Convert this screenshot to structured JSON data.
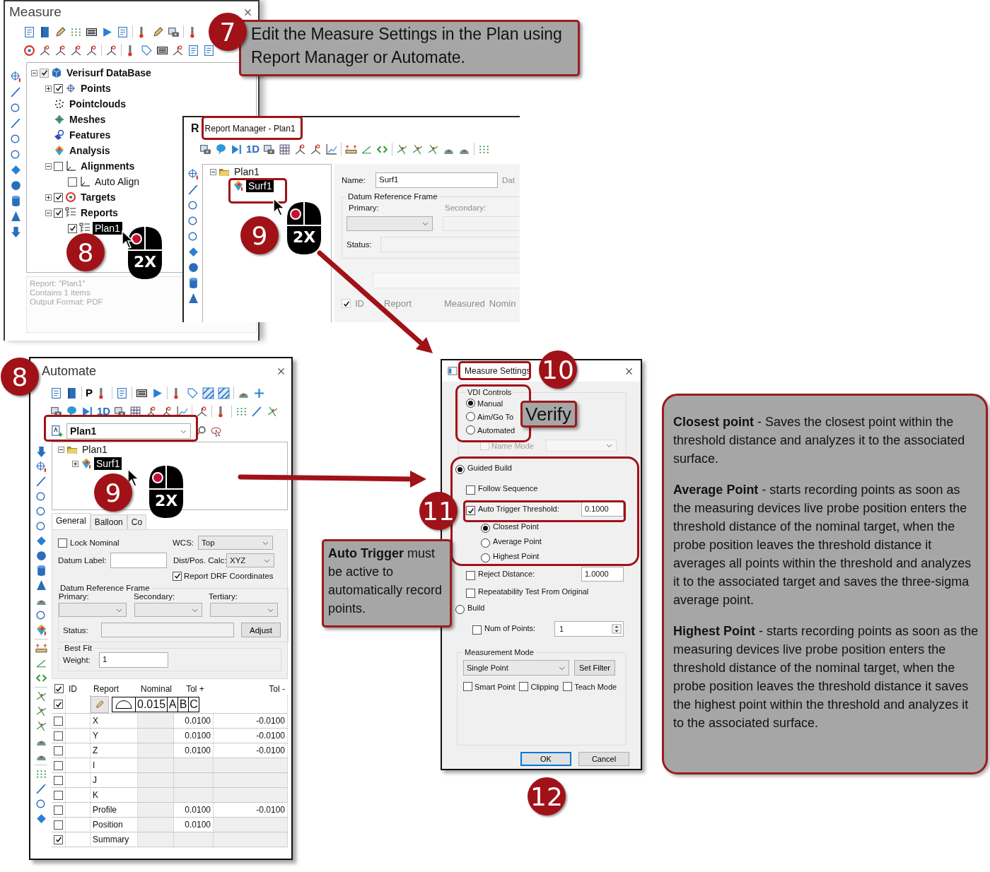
{
  "measure_window": {
    "title": "Measure",
    "tree": [
      {
        "label": "Verisurf DataBase",
        "kind": "database",
        "expanded": true,
        "checked": true,
        "selected": false,
        "children": [
          {
            "label": "Points",
            "kind": "point",
            "expanded": false,
            "checked": true,
            "selected": false
          },
          {
            "label": "Pointclouds",
            "kind": "cloud",
            "selected": false
          },
          {
            "label": "Meshes",
            "kind": "mesh",
            "selected": false
          },
          {
            "label": "Features",
            "kind": "feature",
            "selected": false
          },
          {
            "label": "Analysis",
            "kind": "analysis",
            "selected": false
          },
          {
            "label": "Alignments",
            "kind": "alignment",
            "expanded": true,
            "checked": false,
            "selected": false,
            "children": [
              {
                "label": "Auto Align",
                "kind": "alignment",
                "checked": false,
                "selected": false
              }
            ]
          },
          {
            "label": "Targets",
            "kind": "target",
            "expanded": false,
            "checked": true,
            "selected": false
          },
          {
            "label": "Reports",
            "kind": "report",
            "expanded": true,
            "checked": true,
            "selected": false,
            "children": [
              {
                "label": "Plan1",
                "kind": "report",
                "checked": true,
                "selected": true
              }
            ]
          }
        ]
      }
    ],
    "info": [
      "Report: \"Plan1\"",
      "Contains 1 items",
      "Output Format: PDF"
    ]
  },
  "report_manager": {
    "title_glyph": "R",
    "title": "Report Manager - Plan1",
    "toolbar_text": "1D",
    "tree": [
      {
        "label": "Plan1",
        "kind": "folder",
        "expanded": true,
        "selected": false,
        "children": [
          {
            "label": "Surf1",
            "kind": "surface",
            "selected": true
          }
        ]
      }
    ],
    "name_label": "Name:",
    "name_value": "Surf1",
    "cut_label": "Dat",
    "drf_title": "Datum Reference Frame",
    "primary_label": "Primary:",
    "secondary_label": "Secondary:",
    "status_label": "Status:",
    "faded_header": {
      "checked": true,
      "columns": [
        "ID",
        "Report",
        "Measured",
        "Nomin"
      ]
    }
  },
  "automate": {
    "title": "Automate",
    "toolbar_texts": [
      "P",
      "1D"
    ],
    "plan_select": "Plan1",
    "tree": [
      {
        "label": "Plan1",
        "kind": "folder",
        "expanded": true,
        "selected": false,
        "children": [
          {
            "label": "Surf1",
            "kind": "surface",
            "expanded": false,
            "selected": true
          }
        ]
      }
    ],
    "tabs": [
      {
        "label": "General",
        "selected": true
      },
      {
        "label": "Balloon",
        "selected": false
      },
      {
        "label": "Co",
        "selected": false
      }
    ],
    "general": {
      "lock_nominal": {
        "label": "Lock Nominal",
        "checked": false
      },
      "wcs_label": "WCS:",
      "wcs_value": "Top",
      "datum_label": "Datum Label:",
      "dist_label": "Dist/Pos. Calc:",
      "dist_value": "XYZ",
      "report_drf": {
        "label": "Report DRF Coordinates",
        "checked": true
      },
      "drf_title": "Datum Reference Frame",
      "drf_labels": [
        "Primary:",
        "Secondary:",
        "Tertiary:"
      ],
      "status_label": "Status:",
      "adjust_button": "Adjust",
      "best_fit_title": "Best Fit",
      "weight_label": "Weight:",
      "weight_value": "1"
    },
    "table": {
      "columns": [
        "ID",
        "Report",
        "Nominal",
        "Tol +",
        "Tol -"
      ],
      "all_checked": true,
      "fcf": {
        "checked": true,
        "tolerance": "0.015",
        "datums": [
          "A",
          "B",
          "C"
        ]
      },
      "rows": [
        {
          "report": "X",
          "checked": false,
          "tol_plus": "0.0100",
          "tol_minus": "-0.0100"
        },
        {
          "report": "Y",
          "checked": false,
          "tol_plus": "0.0100",
          "tol_minus": "-0.0100"
        },
        {
          "report": "Z",
          "checked": false,
          "tol_plus": "0.0100",
          "tol_minus": "-0.0100"
        },
        {
          "report": "I",
          "checked": false
        },
        {
          "report": "J",
          "checked": false
        },
        {
          "report": "K",
          "checked": false
        },
        {
          "report": "Profile",
          "checked": false,
          "tol_plus": "0.0100",
          "tol_minus": "-0.0100"
        },
        {
          "report": "Position",
          "checked": false,
          "tol_plus": "0.0100"
        },
        {
          "report": "Summary",
          "checked": true
        }
      ]
    }
  },
  "measure_settings": {
    "title": "Measure Settings",
    "vdi": {
      "title": "VDI Controls",
      "options": [
        {
          "label": "Manual",
          "selected": true
        },
        {
          "label": "Aim/Go To",
          "selected": false
        },
        {
          "label": "Automated",
          "selected": false
        }
      ]
    },
    "name_mode": {
      "label": "Name Mode",
      "checked": false,
      "disabled": true
    },
    "guided_build": {
      "label": "Guided Build",
      "selected": true
    },
    "follow_sequence": {
      "label": "Follow Sequence",
      "checked": false
    },
    "auto_trigger": {
      "label": "Auto Trigger Threshold:",
      "checked": true,
      "value": "0.1000"
    },
    "trigger_points": [
      {
        "label": "Closest Point",
        "selected": true
      },
      {
        "label": "Average Point",
        "selected": false
      },
      {
        "label": "Highest Point",
        "selected": false
      }
    ],
    "reject_distance": {
      "label": "Reject Distance:",
      "checked": false,
      "value": "1.0000"
    },
    "repeatability": {
      "label": "Repeatability Test From Original",
      "checked": false
    },
    "build": {
      "label": "Build",
      "selected": false
    },
    "num_points": {
      "label": "Num of Points:",
      "checked": false,
      "value": "1"
    },
    "measurement_mode": {
      "title": "Measurement Mode",
      "value": "Single Point",
      "filter_button": "Set Filter",
      "options": [
        {
          "label": "Smart Point",
          "checked": false
        },
        {
          "label": "Clipping",
          "checked": false
        },
        {
          "label": "Teach Mode",
          "checked": false
        }
      ]
    },
    "buttons": [
      {
        "label": "OK",
        "default": true
      },
      {
        "label": "Cancel",
        "default": false
      }
    ]
  },
  "annotations": {
    "badges": [
      "7",
      "8",
      "9",
      "8",
      "9",
      "10",
      "11",
      "12"
    ],
    "mouse_hints": [
      "2X",
      "2X",
      "2X"
    ],
    "notes": [
      {
        "text": "Edit the Measure Settings in the Plan using Report Manager or Automate."
      },
      {
        "text": "Verify"
      },
      {
        "text": "**Auto Trigger** must be active to automatically record points."
      }
    ],
    "info_panel": [
      "**Closest point** - Saves the closest point within the threshold distance and analyzes it to the associated surface.",
      "**Average Point** - starts recording points as soon as the measuring devices live probe position enters the threshold distance of the nominal target, when the probe position leaves the threshold distance it averages all points within the threshold and analyzes it to the associated target and saves the three-sigma average point.",
      "**Highest Point** - starts recording points as soon as the measuring devices live probe position enters the threshold distance of the nominal target, when the probe position leaves the threshold distance it saves the highest point within the threshold  and analyzes it to the associated surface."
    ]
  }
}
